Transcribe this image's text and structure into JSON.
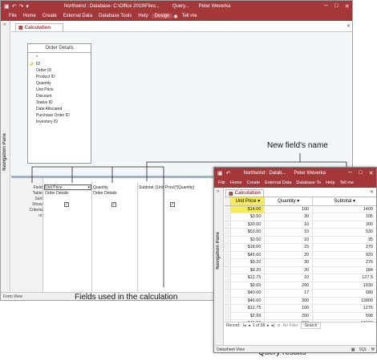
{
  "main": {
    "title": "Northwind : Database- C:\\Office 2019\\Files...",
    "context": "Query...",
    "user": "Peter Weverka",
    "menu": [
      "File",
      "Home",
      "Create",
      "External Data",
      "Database Tools",
      "Help",
      "Design"
    ],
    "tellme": "Tell me",
    "tab_label": "Calculation",
    "nav_pane": "Navigation Pane",
    "table_title": "Order Details",
    "fields": [
      "*",
      "ID",
      "Order ID",
      "Product ID",
      "Quantity",
      "Unit Price",
      "Discount",
      "Status ID",
      "Date Allocated",
      "Purchase Order ID",
      "Inventory ID"
    ],
    "grid_labels": [
      "Field:",
      "Table:",
      "Sort:",
      "Show:",
      "Criteria:",
      "or:"
    ],
    "grid_cols": [
      {
        "field": "Unit Price",
        "table": "Order Details",
        "show": true
      },
      {
        "field": "Quantity",
        "table": "Order Details",
        "show": true
      },
      {
        "field": "Subtotal: [Unit Price]*[Quantity]",
        "table": "",
        "show": true
      }
    ],
    "status": "Form View"
  },
  "query": {
    "title": "Northwind : Datab...",
    "user": "Peter Weverka",
    "menu": [
      "File",
      "Home",
      "Create",
      "External Data",
      "Database To",
      "Help",
      "Tell me"
    ],
    "tab_label": "Calculation",
    "nav_pane": "Navigation Pane",
    "columns": [
      "Unit Price",
      "Quantity",
      "Subtotal"
    ],
    "rows": [
      [
        "$14.00",
        "100",
        "1400"
      ],
      [
        "$3.50",
        "30",
        "105"
      ],
      [
        "$30.00",
        "10",
        "300"
      ],
      [
        "$53.00",
        "10",
        "530"
      ],
      [
        "$3.50",
        "10",
        "35"
      ],
      [
        "$18.00",
        "15",
        "270"
      ],
      [
        "$46.00",
        "20",
        "920"
      ],
      [
        "$9.20",
        "30",
        "276"
      ],
      [
        "$9.20",
        "20",
        "184"
      ],
      [
        "$12.75",
        "10",
        "127.5"
      ],
      [
        "$9.65",
        "200",
        "1930"
      ],
      [
        "$40.00",
        "17",
        "680"
      ],
      [
        "$46.00",
        "300",
        "13800"
      ],
      [
        "$12.75",
        "100",
        "1275"
      ],
      [
        "$2.99",
        "200",
        "598"
      ],
      [
        "$46.00",
        "300",
        "13800"
      ]
    ],
    "record_label": "Record:",
    "record_pos": "1 of 58",
    "no_filter": "No Filter",
    "search": "Search",
    "status": "Datasheet View"
  },
  "callouts": {
    "new_field": "New field's name",
    "fields_used": "Fields used in the calculation",
    "results": "Query results"
  }
}
